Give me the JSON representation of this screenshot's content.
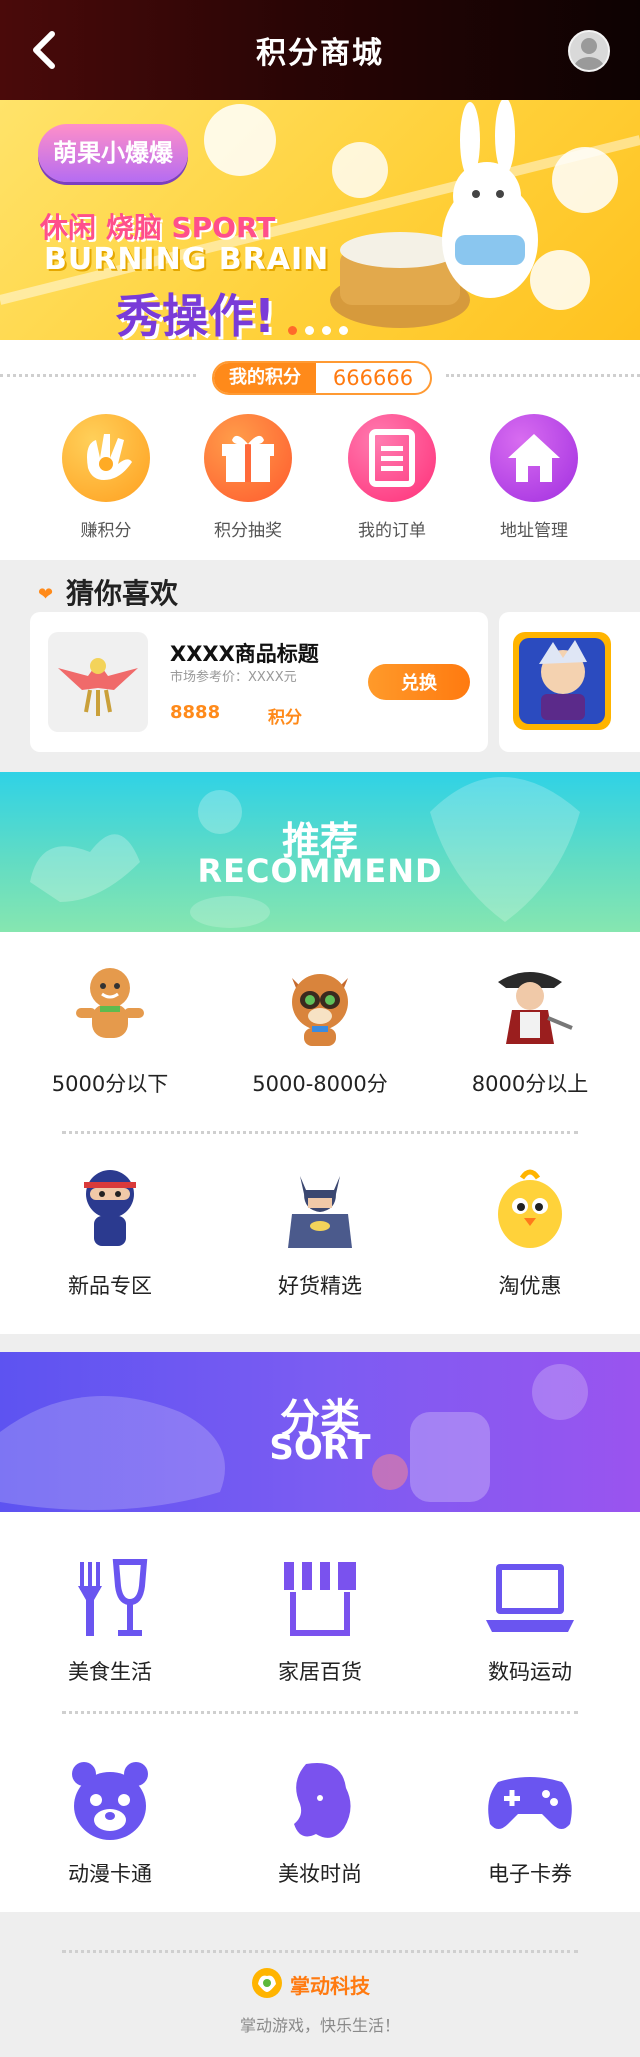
{
  "header": {
    "title": "积分商城",
    "back_icon": "back-arrow-icon",
    "avatar_icon": "user-avatar-icon"
  },
  "banner": {
    "logo_text": "萌果小爆爆",
    "line1": "休闲 烧脑 SPORT",
    "line2": "BURNING BRAIN",
    "line3": "秀操作!",
    "carousel": {
      "count": 4,
      "active": 1
    }
  },
  "points": {
    "label": "我的积分",
    "value": "666666"
  },
  "quick_links": [
    {
      "label": "赚积分",
      "icon": "hand-coin-icon",
      "color": "#ffab25"
    },
    {
      "label": "积分抽奖",
      "icon": "gift-icon",
      "color": "#ff6a3a"
    },
    {
      "label": "我的订单",
      "icon": "order-list-icon",
      "color": "#ff3f8a"
    },
    {
      "label": "地址管理",
      "icon": "home-icon",
      "color": "#b342e6"
    }
  ],
  "guess": {
    "title": "猜你喜欢",
    "items": [
      {
        "name": "XXXX商品标题",
        "ref": "市场参考价：XXXX元",
        "points": "8888",
        "unit": "积分",
        "button": "兑换"
      }
    ]
  },
  "recommend": {
    "title_cn": "推荐",
    "title_en": "RECOMMEND",
    "items": [
      {
        "label": "5000分以下",
        "icon": "gingerbread-icon"
      },
      {
        "label": "5000-8000分",
        "icon": "raccoon-icon"
      },
      {
        "label": "8000分以上",
        "icon": "pirate-icon"
      },
      {
        "label": "新品专区",
        "icon": "ninja-icon"
      },
      {
        "label": "好货精选",
        "icon": "batman-icon"
      },
      {
        "label": "淘优惠",
        "icon": "chick-icon"
      }
    ]
  },
  "sort": {
    "title_cn": "分类",
    "title_en": "SORT",
    "items": [
      {
        "label": "美食生活",
        "icon": "fork-wine-icon"
      },
      {
        "label": "家居百货",
        "icon": "shop-awning-icon"
      },
      {
        "label": "数码运动",
        "icon": "laptop-icon"
      },
      {
        "label": "动漫卡通",
        "icon": "bear-icon"
      },
      {
        "label": "美妆时尚",
        "icon": "woman-profile-icon"
      },
      {
        "label": "电子卡券",
        "icon": "gamepad-icon"
      }
    ]
  },
  "footer": {
    "brand": "掌动科技",
    "slogan": "掌动游戏，快乐生活！"
  },
  "colors": {
    "accent": "#ff8a1a",
    "sort_purple": "#6a55f0",
    "recommend_teal": "#2fd2e6"
  }
}
